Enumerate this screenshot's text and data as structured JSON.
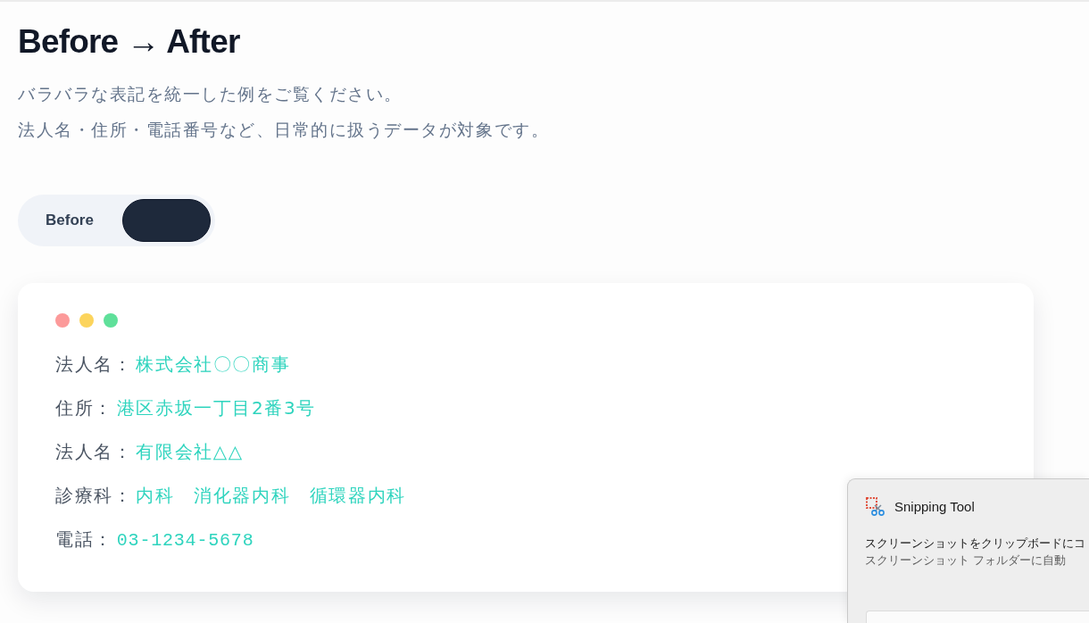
{
  "heading": "Before → After",
  "description": [
    "バラバラな表記を統一した例をご覧ください。",
    "法人名・住所・電話番号など、日常的に扱うデータが対象です。"
  ],
  "toggle": {
    "options": [
      {
        "label": "Before",
        "selected": false
      },
      {
        "selected": true
      }
    ]
  },
  "card": {
    "dots": [
      {
        "color": "#fc9a9a"
      },
      {
        "color": "#fcd45c"
      },
      {
        "color": "#5fe09a"
      }
    ],
    "rows": [
      {
        "kind": "text",
        "label": "法人名：",
        "value": "株式会社〇〇商事"
      },
      {
        "kind": "text",
        "label": "住所：",
        "value": "港区赤坂一丁目2番3号"
      },
      {
        "kind": "text",
        "label": "法人名：",
        "value": "有限会社△△"
      },
      {
        "kind": "text",
        "label": "診療科：",
        "value": "内科　消化器内科　循環器内科"
      },
      {
        "kind": "mono",
        "label": "電話：",
        "value": "03-1234-5678"
      }
    ]
  },
  "notification": {
    "title": "Snipping Tool",
    "message": "スクリーンショットをクリップボードにコ",
    "detail": "スクリーンショット フォルダーに自動"
  }
}
